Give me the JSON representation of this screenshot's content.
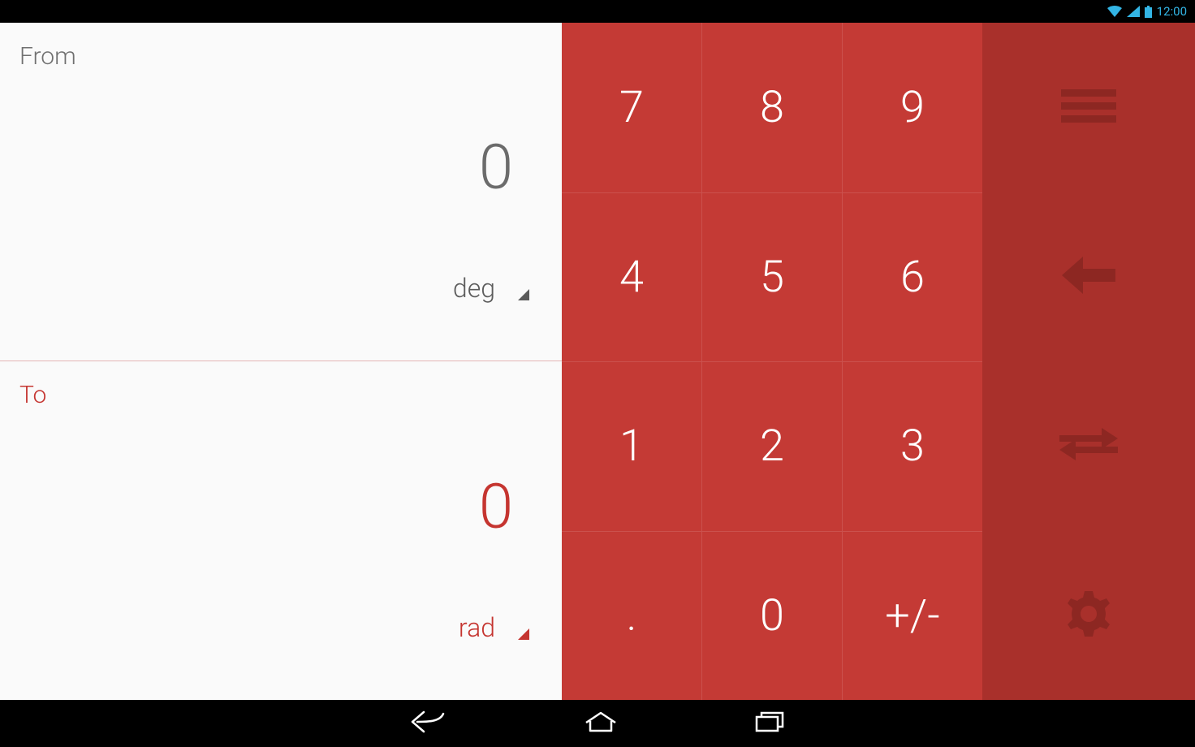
{
  "status": {
    "time": "12:00"
  },
  "converter": {
    "from": {
      "label": "From",
      "value": "0",
      "unit": "deg"
    },
    "to": {
      "label": "To",
      "value": "0",
      "unit": "rad"
    }
  },
  "keypad": {
    "row1": [
      "7",
      "8",
      "9"
    ],
    "row2": [
      "4",
      "5",
      "6"
    ],
    "row3": [
      "1",
      "2",
      "3"
    ],
    "row4": [
      ".",
      "0",
      "+/-"
    ]
  }
}
